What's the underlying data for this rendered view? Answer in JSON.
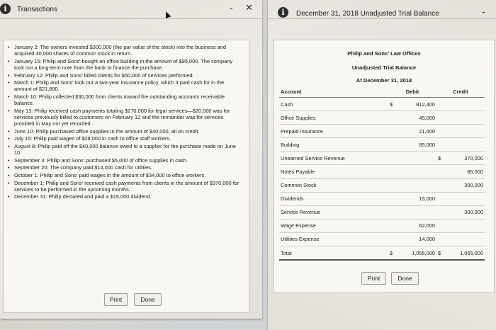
{
  "left_window": {
    "title": "Transactions",
    "minimize": "-",
    "close": "✕",
    "transactions": [
      "January 2: The owners invested $300,000 (the par value of the stock) into the business and acquired 30,000 shares of common stock in return.",
      "January 15: Philip and Sons' bought an office building in the amount of $85,000. The company took out a long-term note from the bank to finance the purchase.",
      "February 12: Philip and Sons' billed clients for $50,000 of services performed.",
      "March 1: Philip and Sons' took out a two-year insurance policy, which it paid cash for in the amount of $21,600.",
      "March 10: Philip collected $30,000 from clients toward the outstanding accounts receivable balance.",
      "May 13: Philip received cash payments totaling $270,000 for legal services—$20,000 was for services previously billed to customers on February 12 and the remainder was for services provided in May not yet recorded.",
      "June 10: Philip purchased office supplies in the amount of $40,000, all on credit.",
      "July 15: Philip paid wages of $28,000 in cash to office staff workers.",
      "August 8: Philip paid off the $40,000 balance owed to a supplier for the purchase made on June 10.",
      "September 3: Philip and Sons' purchased $5,000 of office supplies in cash.",
      "September 20: The company paid $14,000 cash for utilities.",
      "October 1: Philip and Sons' paid wages in the amount of $34,000 to office workers.",
      "December 1: Philip and Sons' received cash payments from clients in the amount of $370,000 for services to be performed in the upcoming months.",
      "December 31: Philip declared and paid a $15,000 dividend."
    ],
    "print_label": "Print",
    "done_label": "Done"
  },
  "right_window": {
    "title": "December 31, 2018 Unadjusted Trial Balance",
    "minimize": "-",
    "company": "Philip and Sons' Law Offices",
    "report_name": "Unadjusted Trial Balance",
    "report_date": "At December 31, 2018",
    "columns": {
      "account": "Account",
      "debit": "Debit",
      "credit": "Credit"
    },
    "rows": [
      {
        "account": "Cash",
        "debit_sign": "$",
        "debit": "812,400",
        "credit_sign": "",
        "credit": ""
      },
      {
        "account": "Office Supplies",
        "debit_sign": "",
        "debit": "45,000",
        "credit_sign": "",
        "credit": ""
      },
      {
        "account": "Prepaid Insurance",
        "debit_sign": "",
        "debit": "21,600",
        "credit_sign": "",
        "credit": ""
      },
      {
        "account": "Building",
        "debit_sign": "",
        "debit": "85,000",
        "credit_sign": "",
        "credit": ""
      },
      {
        "account": "Unearned Service Revenue",
        "debit_sign": "",
        "debit": "",
        "credit_sign": "$",
        "credit": "370,000"
      },
      {
        "account": "Notes Payable",
        "debit_sign": "",
        "debit": "",
        "credit_sign": "",
        "credit": "85,000"
      },
      {
        "account": "Common Stock",
        "debit_sign": "",
        "debit": "",
        "credit_sign": "",
        "credit": "300,000"
      },
      {
        "account": "Dividends",
        "debit_sign": "",
        "debit": "15,000",
        "credit_sign": "",
        "credit": ""
      },
      {
        "account": "Service Revenue",
        "debit_sign": "",
        "debit": "",
        "credit_sign": "",
        "credit": "300,000"
      },
      {
        "account": "Wage Expense",
        "debit_sign": "",
        "debit": "62,000",
        "credit_sign": "",
        "credit": ""
      },
      {
        "account": "Utilities Expense",
        "debit_sign": "",
        "debit": "14,000",
        "credit_sign": "",
        "credit": ""
      }
    ],
    "total": {
      "account": "Total",
      "debit_sign": "$",
      "debit": "1,055,000",
      "credit_sign": "$",
      "credit": "1,055,000"
    },
    "print_label": "Print",
    "done_label": "Done"
  }
}
